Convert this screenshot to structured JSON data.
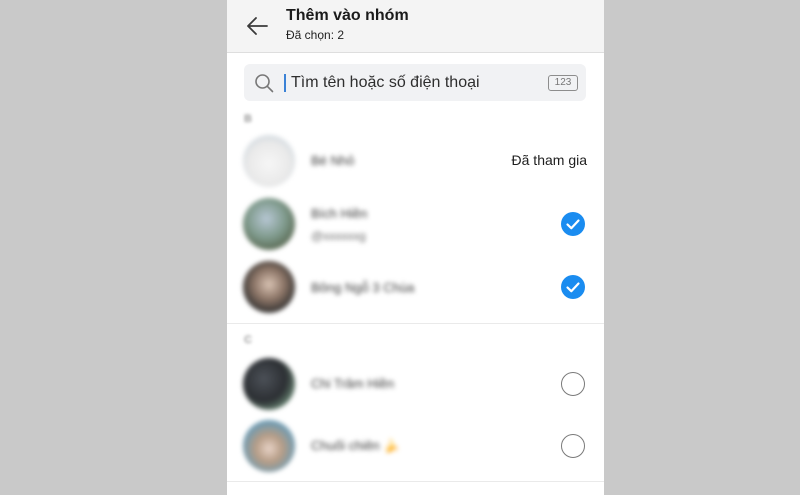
{
  "header": {
    "title": "Thêm vào nhóm",
    "subtitle": "Đã chọn: 2"
  },
  "search": {
    "placeholder": "Tìm tên hoặc số điện thoại",
    "keyboard_toggle": "123"
  },
  "sections": [
    {
      "letter": "B",
      "contacts": [
        {
          "name": "Bé Nhỏ",
          "sub": "",
          "status": "joined",
          "status_label": "Đã tham gia"
        },
        {
          "name": "Bích Hiền",
          "sub": "@xxxxxxg",
          "status": "selected"
        },
        {
          "name": "Bông Ngỗ 3 Chùa",
          "sub": "",
          "status": "selected"
        }
      ]
    },
    {
      "letter": "C",
      "contacts": [
        {
          "name": "Chi Trâm Hiền",
          "sub": "",
          "status": "unselected"
        },
        {
          "name": "Chuối chiên 🍌",
          "sub": "",
          "status": "unselected"
        }
      ]
    }
  ],
  "colors": {
    "accent": "#1a8cf0",
    "header_bg": "#f4f4f4",
    "backdrop": "#c9c9c9"
  }
}
